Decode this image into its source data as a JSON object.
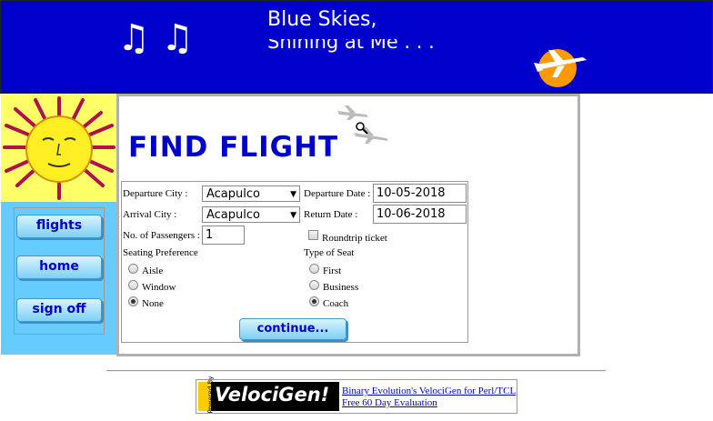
{
  "banner": {
    "title": "Blue Skies,",
    "subtitle": "Shining at Me . . ."
  },
  "sidebar": {
    "nav": [
      {
        "label": "flights"
      },
      {
        "label": "home"
      },
      {
        "label": "sign off"
      }
    ]
  },
  "page": {
    "title": "FIND FLIGHT"
  },
  "form": {
    "departure_city_label": "Departure City :",
    "departure_city_value": "Acapulco",
    "departure_date_label": "Departure Date :",
    "departure_date_value": "10-05-2018",
    "arrival_city_label": "Arrival City :",
    "arrival_city_value": "Acapulco",
    "return_date_label": "Return Date :",
    "return_date_value": "10-06-2018",
    "passengers_label": "No. of Passengers :",
    "passengers_value": "1",
    "roundtrip_label": "Roundtrip ticket",
    "seating_pref_label": "Seating Preference",
    "seating_options": [
      "Aisle",
      "Window",
      "None"
    ],
    "seating_selected": "None",
    "seat_type_label": "Type of Seat",
    "seat_type_options": [
      "First",
      "Business",
      "Coach"
    ],
    "seat_type_selected": "Coach",
    "continue_label": "continue..."
  },
  "ad": {
    "powered_by": "Powered By",
    "brand": "VelociGen!",
    "line1": "Binary Evolution's VelociGen for Perl/TCL",
    "line2": "Free 60 Day Evaluation"
  },
  "colors": {
    "banner_bg": "#0000cc",
    "sidebar_bg": "#66ccff",
    "title_color": "#0000cc"
  }
}
